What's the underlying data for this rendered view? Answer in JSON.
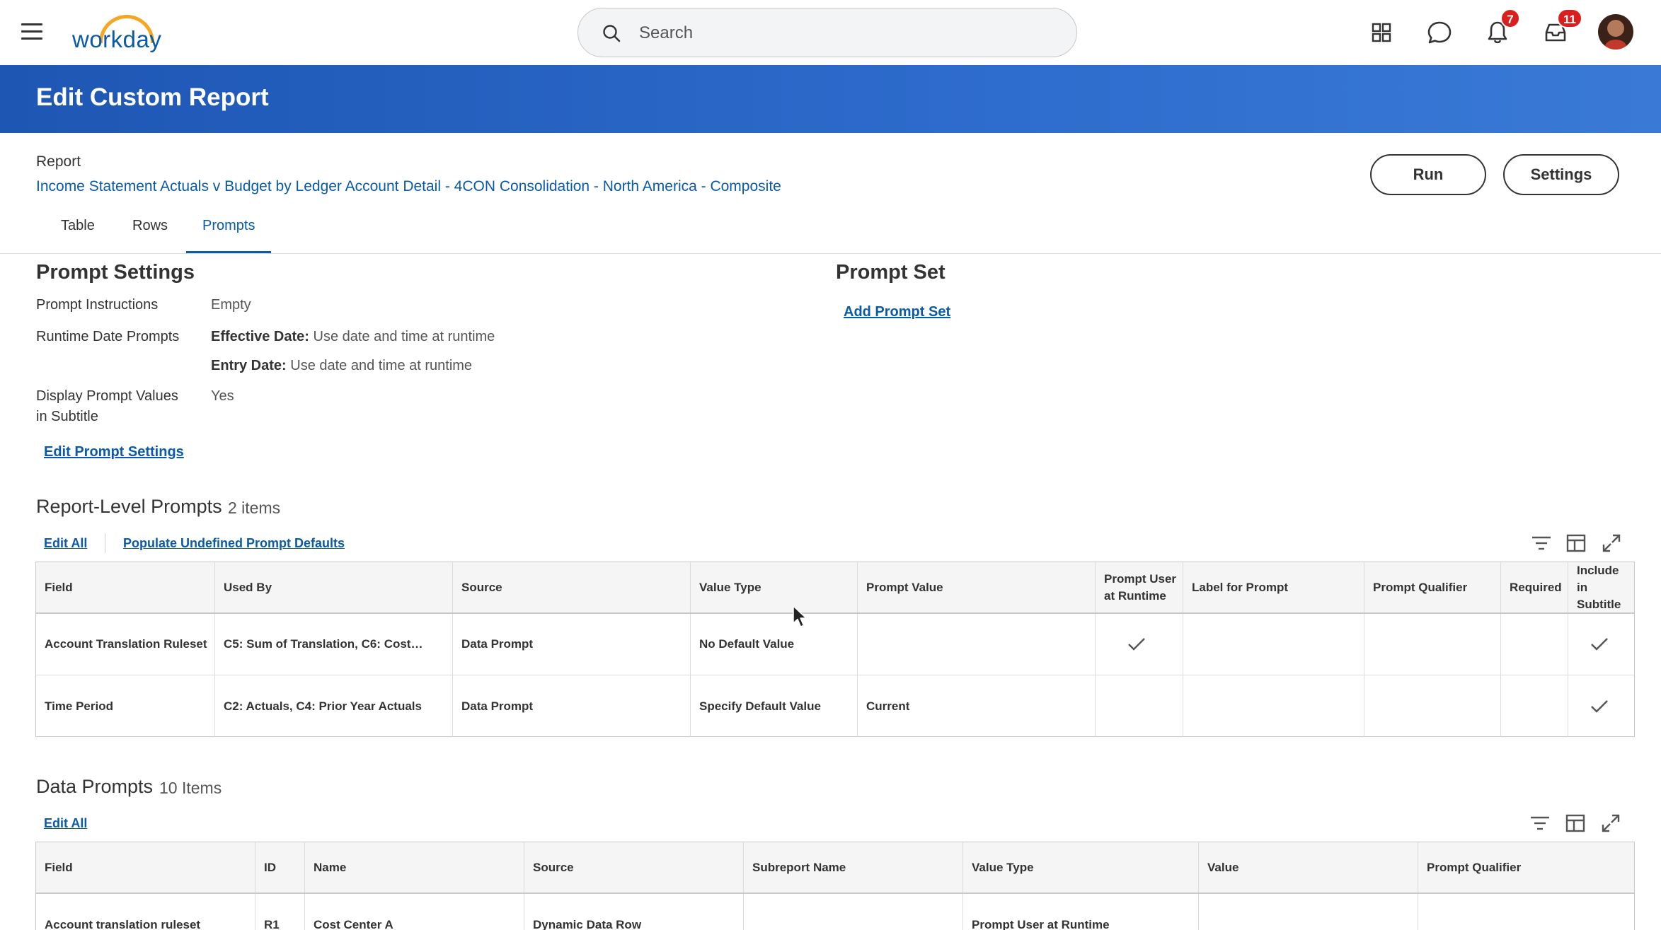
{
  "app": {
    "logo_text": "workday",
    "logo_arc_color": "#f5a623",
    "brand_color": "#0b5aa8"
  },
  "search": {
    "placeholder": "Search"
  },
  "topbar": {
    "icons": [
      "apps-grid-icon",
      "chat-icon",
      "bell-icon",
      "inbox-icon"
    ],
    "notifications_count": "7",
    "inbox_count": "11",
    "badge_color": "#d9201f"
  },
  "page": {
    "title": "Edit Custom Report"
  },
  "report": {
    "label": "Report",
    "name": "Income Statement Actuals v Budget by Ledger Account Detail - 4CON Consolidation - North America - Composite",
    "run_label": "Run",
    "settings_label": "Settings"
  },
  "tabs": [
    {
      "label": "Table",
      "active": false
    },
    {
      "label": "Rows",
      "active": false
    },
    {
      "label": "Prompts",
      "active": true
    }
  ],
  "prompt_settings": {
    "heading": "Prompt Settings",
    "instructions_label": "Prompt Instructions",
    "instructions_value": "Empty",
    "runtime_label": "Runtime Date Prompts",
    "effective_label": "Effective Date:",
    "effective_value": " Use date and time at runtime",
    "entry_label": "Entry Date:",
    "entry_value": " Use date and time at runtime",
    "display_label_line1": "Display Prompt Values",
    "display_label_line2": "in Subtitle",
    "display_value": "Yes",
    "edit_link": "Edit Prompt Settings"
  },
  "prompt_set": {
    "heading": "Prompt Set",
    "add_link": "Add Prompt Set"
  },
  "report_level_prompts": {
    "title": "Report-Level Prompts",
    "count": "2 items",
    "edit_all": "Edit All",
    "populate": "Populate Undefined Prompt Defaults",
    "columns": [
      "Field",
      "Used By",
      "Source",
      "Value Type",
      "Prompt Value",
      "Prompt User at Runtime",
      "Label for Prompt",
      "Prompt Qualifier",
      "Required",
      "Include in Subtitle"
    ],
    "rows": [
      {
        "field": "Account Translation Ruleset",
        "used_by": "C5:  Sum of Translation, C6: Cost…",
        "source": "Data Prompt",
        "value_type": "No Default Value",
        "prompt_value": "",
        "prompt_user": true,
        "label": "",
        "qualifier": "",
        "required": false,
        "include_subtitle": true
      },
      {
        "field": "Time Period",
        "used_by": "C2:  Actuals, C4: Prior Year Actuals",
        "source": "Data Prompt",
        "value_type": "Specify Default Value",
        "prompt_value": "Current",
        "prompt_user": false,
        "label": "",
        "qualifier": "",
        "required": false,
        "include_subtitle": true
      }
    ]
  },
  "data_prompts": {
    "title": "Data Prompts",
    "count": "10 Items",
    "edit_all": "Edit All",
    "columns": [
      "Field",
      "ID",
      "Name",
      "Source",
      "Subreport Name",
      "Value Type",
      "Value",
      "Prompt Qualifier"
    ],
    "rows": [
      {
        "field": "Account translation ruleset",
        "id": "R1",
        "name": "Cost Center A",
        "source": "Dynamic Data Row",
        "subreport": "",
        "value_type": "Prompt User at Runtime",
        "value": "",
        "qualifier": ""
      }
    ]
  }
}
